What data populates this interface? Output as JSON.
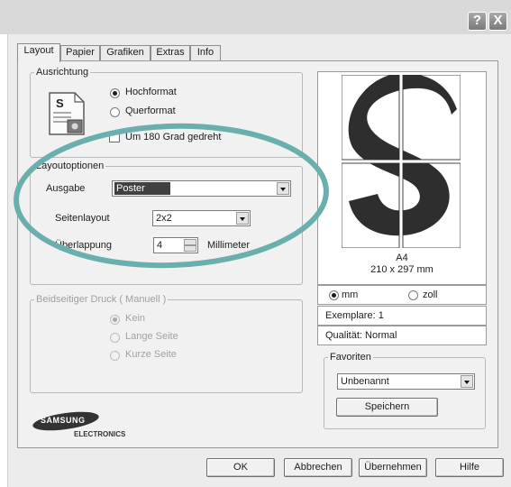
{
  "titlebar": {
    "help_label": "?",
    "close_label": "X"
  },
  "tabs": [
    "Layout",
    "Papier",
    "Grafiken",
    "Extras",
    "Info"
  ],
  "orientation": {
    "legend": "Ausrichtung",
    "portrait": "Hochformat",
    "landscape": "Querformat",
    "rotate": "Um 180 Grad gedreht"
  },
  "layout_options": {
    "legend": "Layoutoptionen",
    "output_label": "Ausgabe",
    "output_value": "Poster",
    "page_layout_label": "Seitenlayout",
    "page_layout_value": "2x2",
    "overlap_label": "Überlappung",
    "overlap_value": "4",
    "overlap_unit": "Millimeter"
  },
  "duplex": {
    "legend": "Beidseitiger Druck ( Manuell )",
    "none": "Kein",
    "long_edge": "Lange Seite",
    "short_edge": "Kurze Seite"
  },
  "brand": {
    "name": "SAMSUNG",
    "sub": "ELECTRONICS"
  },
  "preview": {
    "paper_name": "A4",
    "paper_size": "210 x 297 mm",
    "unit_mm": "mm",
    "unit_inch": "zoll",
    "copies": "Exemplare: 1",
    "quality": "Qualität: Normal"
  },
  "favorites": {
    "legend": "Favoriten",
    "value": "Unbenannt",
    "save": "Speichern"
  },
  "footer": {
    "ok": "OK",
    "cancel": "Abbrechen",
    "apply": "Übernehmen",
    "help": "Hilfe"
  },
  "colors": {
    "annotation_ellipse": "#6aafad",
    "selection": "#404040",
    "s_glyph": "#2e2e2e"
  }
}
